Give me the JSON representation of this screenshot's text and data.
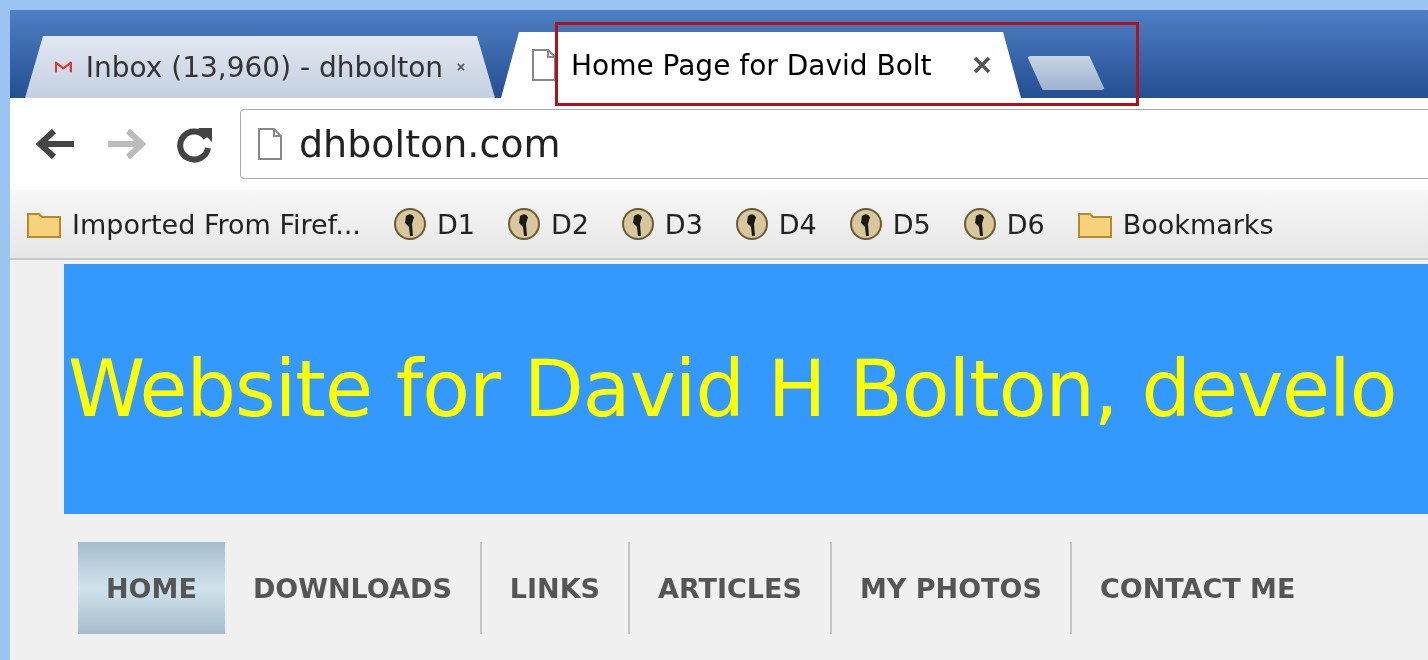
{
  "tabs": [
    {
      "label": "Inbox (13,960) - dhbolton",
      "kind": "mail",
      "selected": false
    },
    {
      "label": "Home Page for David Bolt",
      "kind": "page",
      "selected": true
    }
  ],
  "address": "dhbolton.com",
  "bookmarks": [
    {
      "label": "Imported From Firef...",
      "kind": "folder"
    },
    {
      "label": "D1",
      "kind": "site"
    },
    {
      "label": "D2",
      "kind": "site"
    },
    {
      "label": "D3",
      "kind": "site"
    },
    {
      "label": "D4",
      "kind": "site"
    },
    {
      "label": "D5",
      "kind": "site"
    },
    {
      "label": "D6",
      "kind": "site"
    },
    {
      "label": "Bookmarks",
      "kind": "folder"
    }
  ],
  "header": {
    "title": "Website for David H Bolton, develo"
  },
  "nav": [
    {
      "label": "HOME",
      "selected": true
    },
    {
      "label": "DOWNLOADS",
      "selected": false
    },
    {
      "label": "LINKS",
      "selected": false
    },
    {
      "label": "ARTICLES",
      "selected": false
    },
    {
      "label": "MY PHOTOS",
      "selected": false
    },
    {
      "label": "CONTACT ME",
      "selected": false
    }
  ]
}
